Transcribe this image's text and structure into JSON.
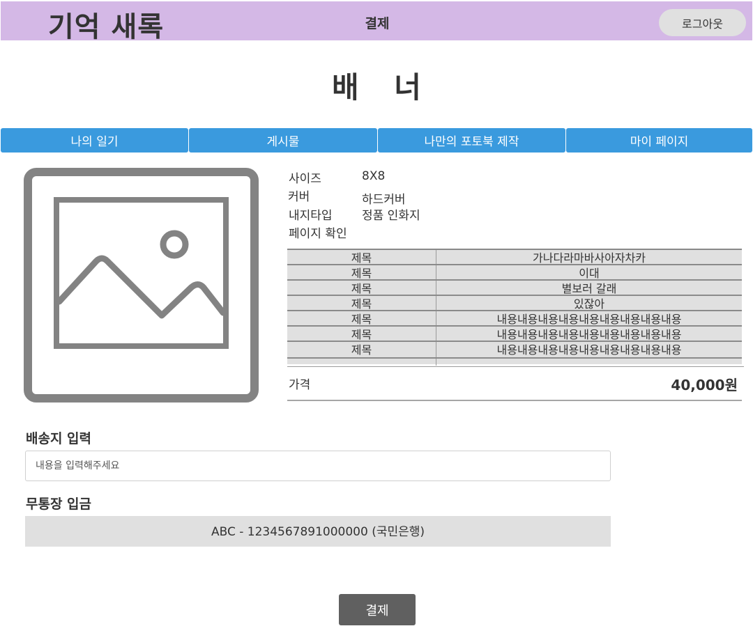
{
  "header": {
    "logo": "기억 새록",
    "title": "결제",
    "logout_label": "로그아웃"
  },
  "banner": {
    "text": "배 너"
  },
  "nav": {
    "tabs": [
      {
        "label": "나의 일기"
      },
      {
        "label": "게시물"
      },
      {
        "label": "나만의 포토북 제작"
      },
      {
        "label": "마이 페이지"
      }
    ]
  },
  "product": {
    "image_icon": "image-placeholder-icon",
    "specs": [
      {
        "label": "사이즈",
        "value": "8X8"
      },
      {
        "label": "커버",
        "value": "하드커버"
      },
      {
        "label": "내지타입",
        "value": "정품 인화지"
      },
      {
        "label": "페이지 확인",
        "value": ""
      }
    ],
    "pages": [
      {
        "title": "제목",
        "content": "가나다라마바사아자차카"
      },
      {
        "title": "제목",
        "content": "이대"
      },
      {
        "title": "제목",
        "content": "별보러 갈래"
      },
      {
        "title": "제목",
        "content": "있잖아"
      },
      {
        "title": "제목",
        "content": "내용내용내용내용내용내용내용내용내용"
      },
      {
        "title": "제목",
        "content": "내용내용내용내용내용내용내용내용내용"
      },
      {
        "title": "제목",
        "content": "내용내용내용내용내용내용내용내용내용"
      }
    ],
    "price_label": "가격",
    "price_value": "40,000원"
  },
  "shipping": {
    "heading": "배송지 입력",
    "placeholder": "내용을 입력해주세요"
  },
  "bank": {
    "heading": "무통장 입금",
    "account": "ABC - 1234567891000000 (국민은행)"
  },
  "pay_button_label": "결제",
  "colors": {
    "header_bg": "#d4b8e6",
    "nav_bg": "#3a9ade",
    "panel_gray": "#e0e0e0",
    "button_dark": "#606060"
  }
}
